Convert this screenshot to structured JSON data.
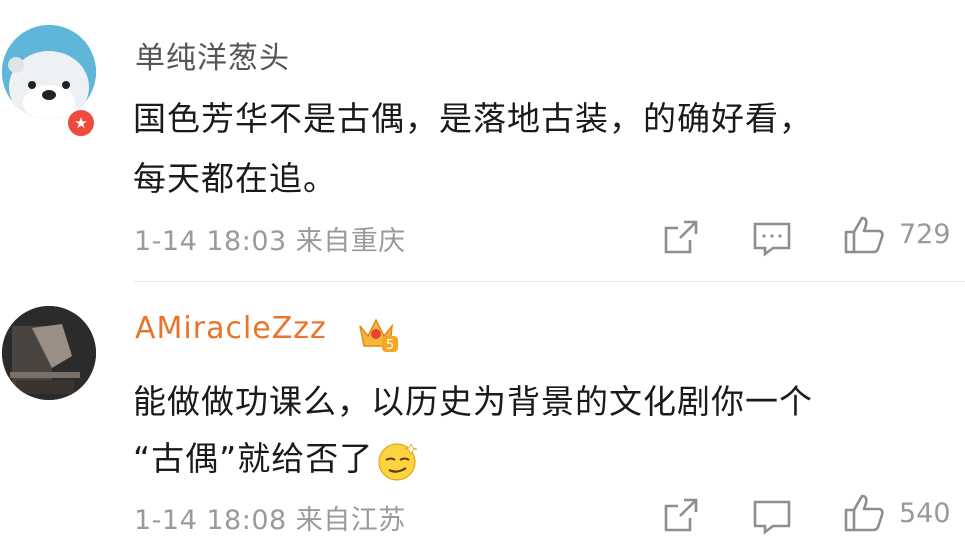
{
  "comments": [
    {
      "username": "单纯洋葱头",
      "lines": [
        "国色芳华不是古偶，是落地古装，的确好看，",
        "每天都在追。"
      ],
      "timestamp": "1-14 18:03",
      "location": "来自重庆",
      "likes": "729",
      "verified_badge_icon": "star",
      "avatar_desc": "otter-cartoon"
    },
    {
      "username": "AMiracleZzz",
      "vip_badge_level": "5",
      "lines": [
        "能做做功课么，以历史为背景的文化剧你一个",
        "“古偶”就给否了"
      ],
      "emoji": "smirk-face",
      "timestamp": "1-14 18:08",
      "location": "来自江苏",
      "likes": "540"
    }
  ],
  "colors": {
    "username_normal": "#555555",
    "username_vip": "#e8752a",
    "meta_gray": "#9a9a9a",
    "verified_red": "#ef4a3f"
  }
}
